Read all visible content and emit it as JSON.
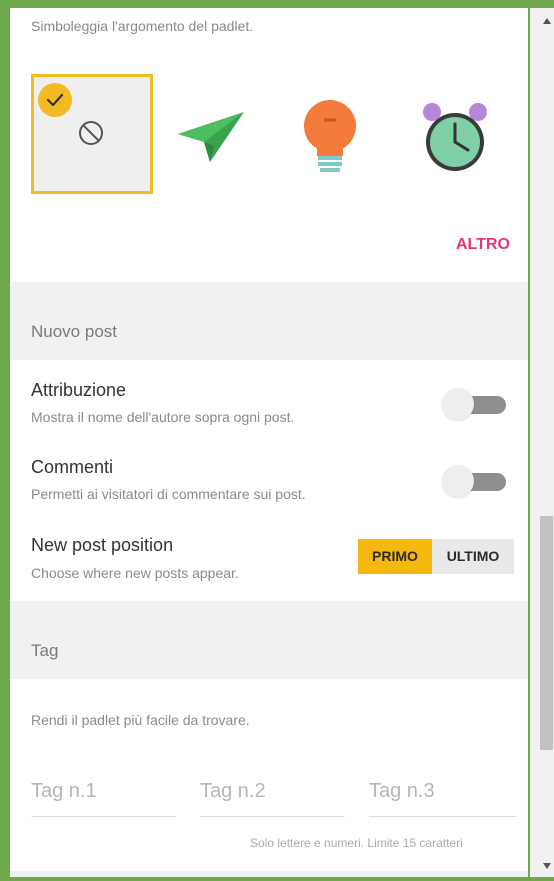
{
  "icon_section": {
    "description": "Simboleggia l'argomento del padlet.",
    "icons": [
      "no-symbol-icon",
      "paper-plane-icon",
      "light-bulb-icon",
      "alarm-clock-icon"
    ],
    "selected_index": 0,
    "more_label": "ALTRO"
  },
  "new_post": {
    "header": "Nuovo post",
    "attribution": {
      "title": "Attribuzione",
      "description": "Mostra il nome dell'autore sopra ogni post.",
      "enabled": false
    },
    "comments": {
      "title": "Commenti",
      "description": "Permetti ai visitatori di commentare sui post.",
      "enabled": false
    },
    "position": {
      "title": "New post position",
      "description": "Choose where new posts appear.",
      "options": [
        "PRIMO",
        "ULTIMO"
      ],
      "selected": "PRIMO"
    }
  },
  "tags": {
    "header": "Tag",
    "description": "Rendi il padlet più facile da trovare.",
    "placeholders": [
      "Tag n.1",
      "Tag n.2",
      "Tag n.3"
    ],
    "hint": "Solo lettere e numeri. Limite 15 caratteri"
  },
  "colors": {
    "accent_yellow": "#f5b80e",
    "more_link_pink": "#e6347a",
    "frame_green": "#6fa84a"
  }
}
